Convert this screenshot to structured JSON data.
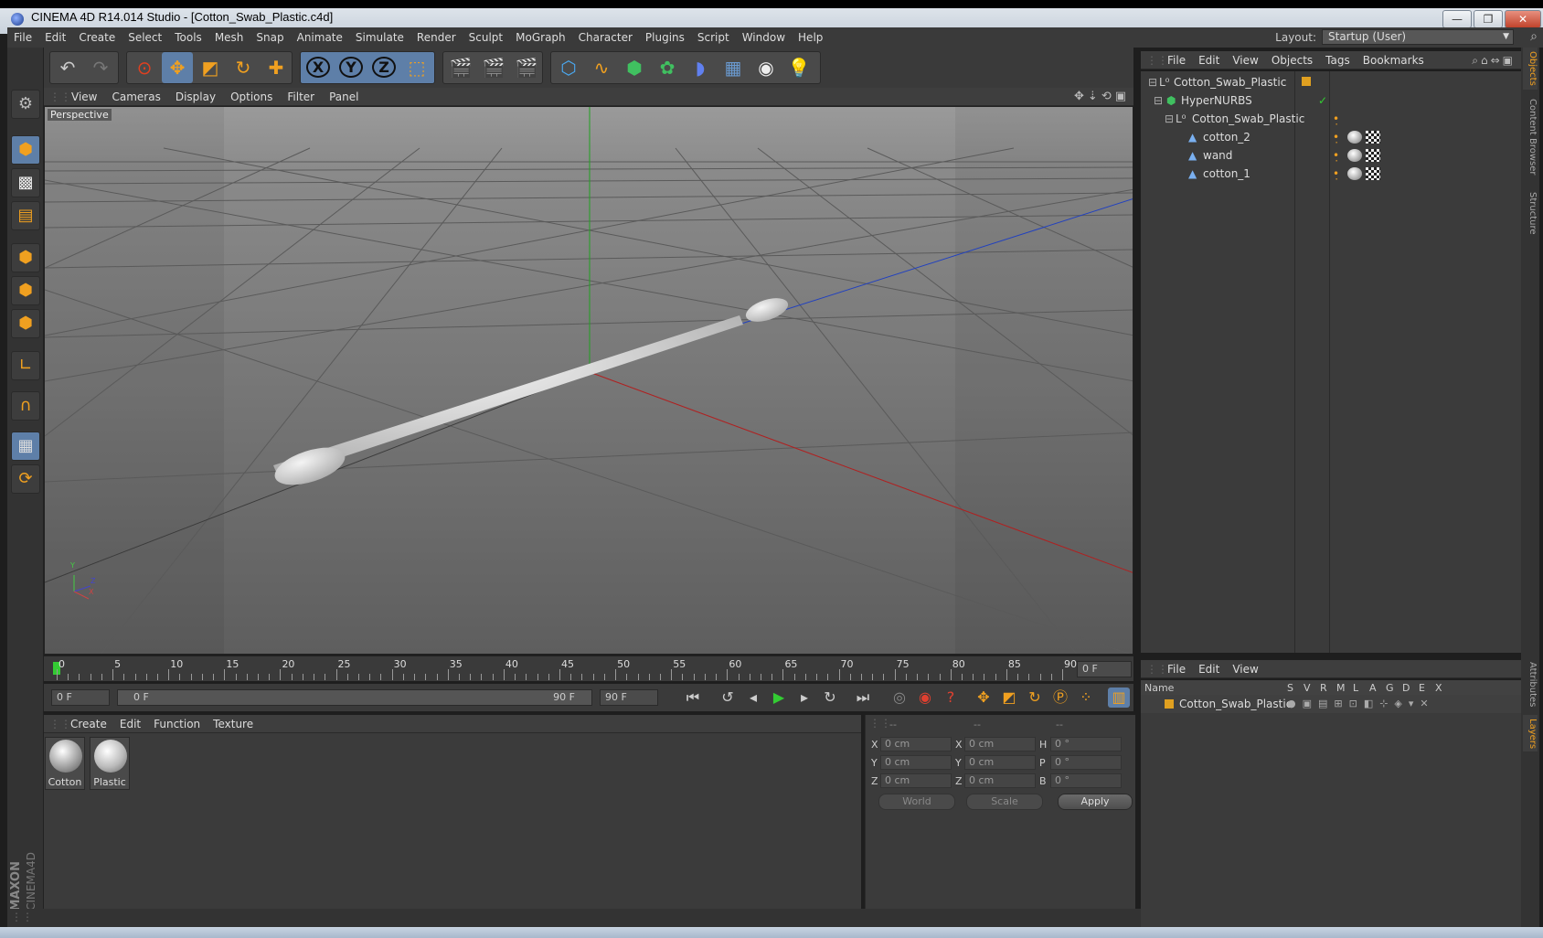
{
  "window": {
    "title": "CINEMA 4D R14.014 Studio - [Cotton_Swab_Plastic.c4d]",
    "controls": [
      "—",
      "❐",
      "✕"
    ]
  },
  "menu": [
    "File",
    "Edit",
    "Create",
    "Select",
    "Tools",
    "Mesh",
    "Snap",
    "Animate",
    "Simulate",
    "Render",
    "Sculpt",
    "MoGraph",
    "Character",
    "Plugins",
    "Script",
    "Window",
    "Help"
  ],
  "layout": {
    "label": "Layout:",
    "value": "Startup (User)"
  },
  "toolbar": {
    "axis_x": "X",
    "axis_y": "Y",
    "axis_z": "Z"
  },
  "viewport": {
    "menu": [
      "View",
      "Cameras",
      "Display",
      "Options",
      "Filter",
      "Panel"
    ],
    "label": "Perspective",
    "axis_labels": {
      "y": "Y",
      "z": "Z",
      "x": "X"
    },
    "colors": {
      "x_axis": "#b02020",
      "y_axis": "#20a020",
      "z_axis": "#2040c0",
      "bg_top": "#9a9a9a",
      "bg_bottom": "#6a6a6a"
    }
  },
  "timeline": {
    "ticks": [
      "0",
      "5",
      "10",
      "15",
      "20",
      "25",
      "30",
      "35",
      "40",
      "45",
      "50",
      "55",
      "60",
      "65",
      "70",
      "75",
      "80",
      "85",
      "90"
    ],
    "current_frame": "0 F"
  },
  "transport": {
    "start_field": "0 F",
    "range_start": "0 F",
    "range_end": "90 F",
    "end_field": "90 F"
  },
  "materials": {
    "menu": [
      "Create",
      "Edit",
      "Function",
      "Texture"
    ],
    "items": [
      {
        "name": "Cotton"
      },
      {
        "name": "Plastic"
      }
    ]
  },
  "brand": {
    "line1": "MAXON",
    "line2": "CINEMA4D"
  },
  "coords": {
    "headers": [
      "--",
      "--",
      "--"
    ],
    "rows": [
      {
        "l1": "X",
        "v1": "0 cm",
        "l2": "X",
        "v2": "0 cm",
        "l3": "H",
        "v3": "0 °"
      },
      {
        "l1": "Y",
        "v1": "0 cm",
        "l2": "Y",
        "v2": "0 cm",
        "l3": "P",
        "v3": "0 °"
      },
      {
        "l1": "Z",
        "v1": "0 cm",
        "l2": "Z",
        "v2": "0 cm",
        "l3": "B",
        "v3": "0 °"
      }
    ],
    "space": "World",
    "mode": "Scale",
    "apply": "Apply"
  },
  "objects": {
    "menu": [
      "File",
      "Edit",
      "View",
      "Objects",
      "Tags",
      "Bookmarks"
    ],
    "tree": [
      {
        "name": "Cotton_Swab_Plastic",
        "depth": 0
      },
      {
        "name": "HyperNURBS",
        "depth": 1
      },
      {
        "name": "Cotton_Swab_Plastic",
        "depth": 2
      },
      {
        "name": "cotton_2",
        "depth": 3
      },
      {
        "name": "wand",
        "depth": 3
      },
      {
        "name": "cotton_1",
        "depth": 3
      }
    ]
  },
  "layers": {
    "menu": [
      "File",
      "Edit",
      "View"
    ],
    "columns": [
      "Name",
      "S",
      "V",
      "R",
      "M",
      "L",
      "A",
      "G",
      "D",
      "E",
      "X"
    ],
    "rows": [
      {
        "name": "Cotton_Swab_Plastic",
        "color": "#e0a020"
      }
    ]
  },
  "right_tabs": [
    "Objects",
    "Content Browser",
    "Structure",
    "Attributes",
    "Layers"
  ]
}
